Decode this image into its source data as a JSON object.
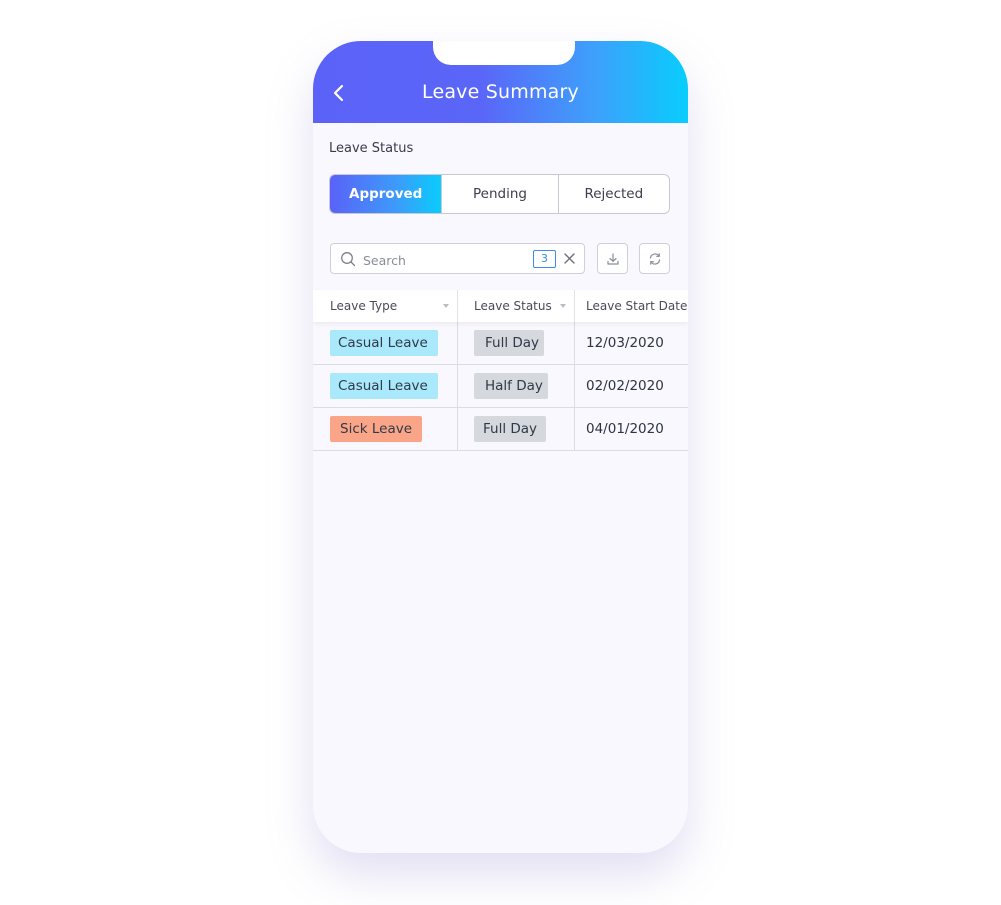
{
  "header": {
    "title": "Leave Summary",
    "back_icon": "chevron-left-icon"
  },
  "leave_status": {
    "label": "Leave Status",
    "options": [
      {
        "label": "Approved",
        "active": true
      },
      {
        "label": "Pending",
        "active": false
      },
      {
        "label": "Rejected",
        "active": false
      }
    ]
  },
  "toolbar": {
    "search_placeholder": "Search",
    "search_value": "",
    "result_count": "3",
    "search_icon": "search-icon",
    "clear_icon": "close-icon",
    "download_icon": "download-icon",
    "refresh_icon": "refresh-icon"
  },
  "table": {
    "columns": [
      "Leave Type",
      "Leave Status",
      "Leave Start Date"
    ],
    "rows": [
      {
        "type": "Casual Leave",
        "type_kind": "casual",
        "status": "Full Day",
        "start_date": "12/03/2020"
      },
      {
        "type": "Casual Leave",
        "type_kind": "casual",
        "status": "Half Day",
        "start_date": "02/02/2020"
      },
      {
        "type": "Sick Leave",
        "type_kind": "sick",
        "status": "Full Day",
        "start_date": "04/01/2020"
      }
    ]
  },
  "colors": {
    "accent_start": "#5b62f8",
    "accent_end": "#08cdfd",
    "casual_chip": "#a9e9fb",
    "sick_chip": "#fba588",
    "duration_chip": "#d5d8dc",
    "count_badge": "#3b8de5"
  }
}
